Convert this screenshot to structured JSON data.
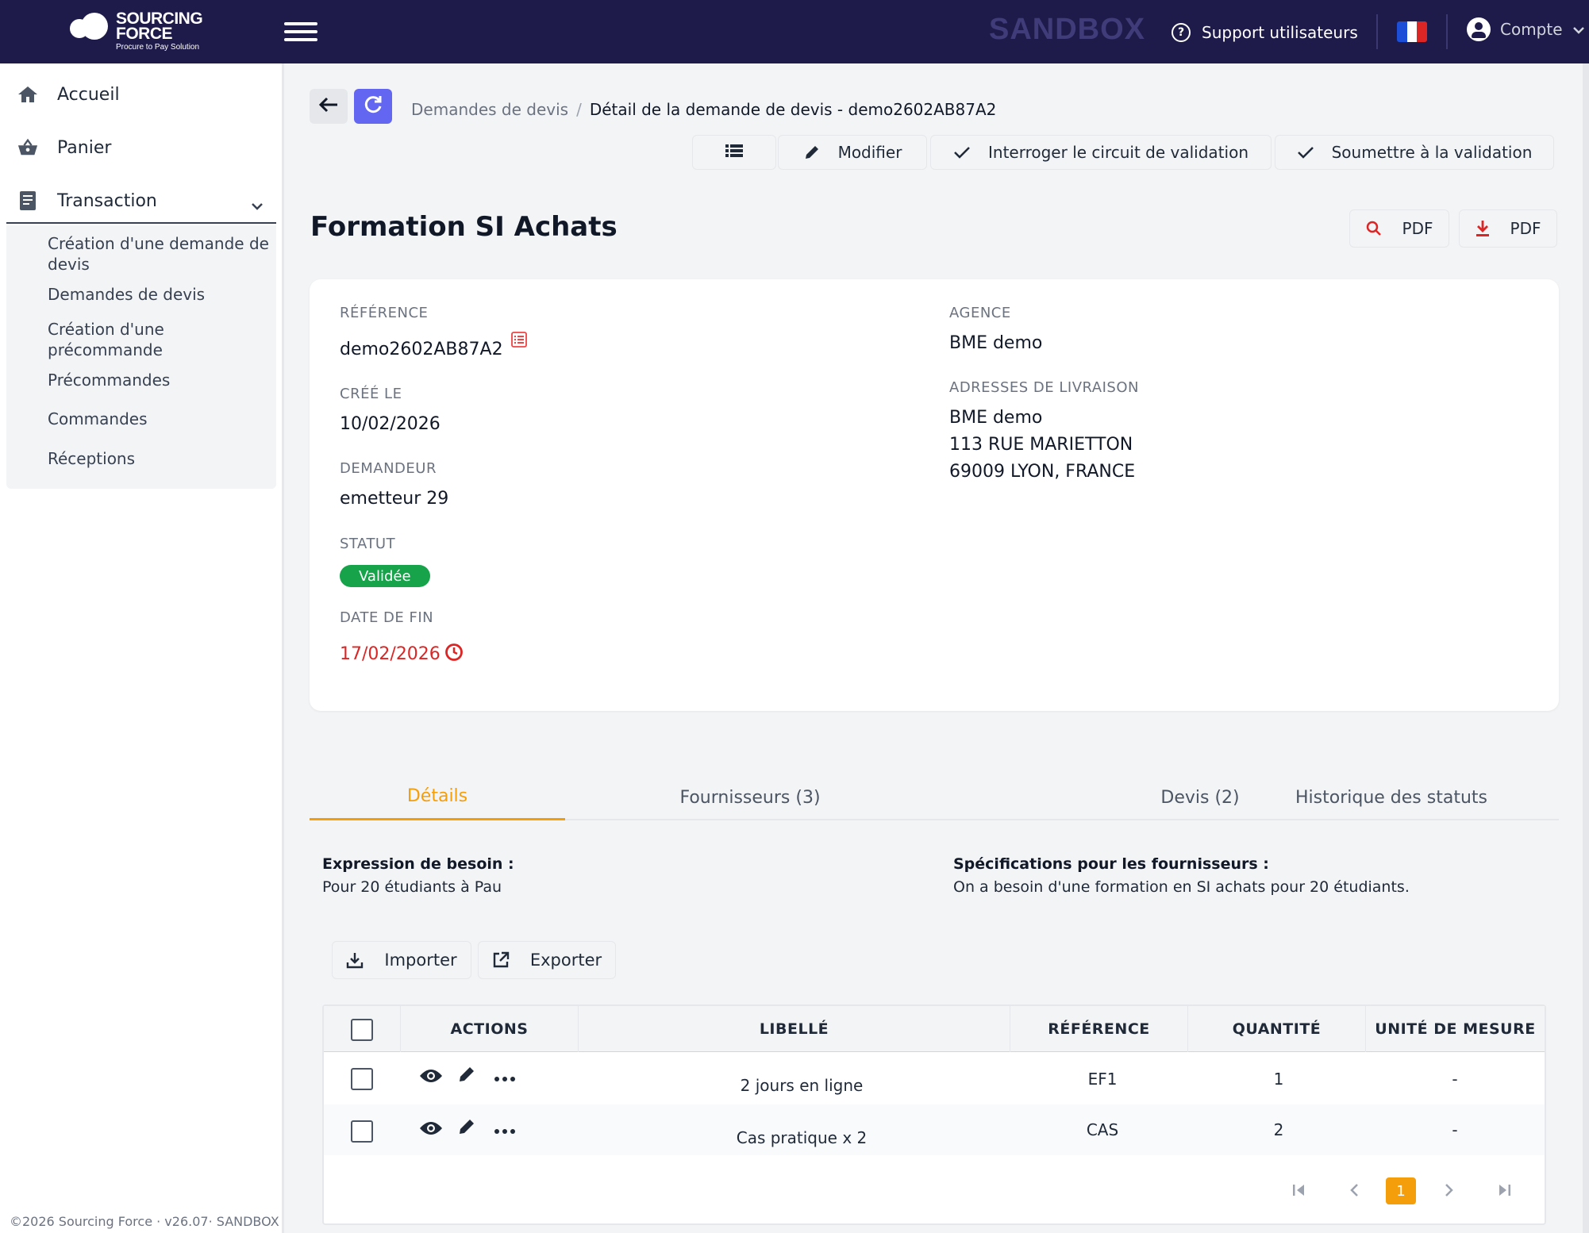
{
  "header": {
    "logo_line1": "SOURCING",
    "logo_line2": "FORCE",
    "logo_sub": "Procure to Pay Solution",
    "env": "SANDBOX",
    "support": "Support utilisateurs",
    "account": "Compte"
  },
  "sidebar": {
    "home": "Accueil",
    "cart": "Panier",
    "transaction": "Transaction",
    "sub": [
      "Création d'une demande de devis",
      "Demandes de devis",
      "Création d'une précommande",
      "Précommandes",
      "Commandes",
      "Réceptions"
    ],
    "footer": "©2026 Sourcing Force · v26.07· SANDBOX"
  },
  "breadcrumb": {
    "parent": "Demandes de devis",
    "separator": "/",
    "current": "Détail de la demande de devis - demo2602AB87A2"
  },
  "toolbar": {
    "edit": "Modifier",
    "query_circuit": "Interroger le circuit de validation",
    "submit": "Soumettre à la validation"
  },
  "page": {
    "title": "Formation SI Achats",
    "pdf_view": "PDF",
    "pdf_download": "PDF"
  },
  "details": {
    "ref_label": "RÉFÉRENCE",
    "ref_value": "demo2602AB87A2",
    "created_label": "CRÉÉ LE",
    "created_value": "10/02/2026",
    "requester_label": "DEMANDEUR",
    "requester_value": "emetteur 29",
    "status_label": "STATUT",
    "status_value": "Validée",
    "end_label": "DATE DE FIN",
    "end_value": "17/02/2026",
    "agency_label": "AGENCE",
    "agency_value": "BME demo",
    "delivery_label": "ADRESSES DE LIVRAISON",
    "delivery_lines": [
      "BME demo",
      "113 RUE MARIETTON",
      "69009 LYON, FRANCE"
    ]
  },
  "tabs": [
    "Détails",
    "Fournisseurs (3)",
    "Devis (2)",
    "Historique des statuts"
  ],
  "needs": {
    "expr_label": "Expression de besoin :",
    "expr_value": "Pour 20 étudiants à Pau",
    "spec_label": "Spécifications pour les fournisseurs :",
    "spec_value": "On a besoin d'une formation en SI achats pour 20 étudiants."
  },
  "actions": {
    "import": "Importer",
    "export": "Exporter"
  },
  "table": {
    "columns": [
      "ACTIONS",
      "LIBELLÉ",
      "RÉFÉRENCE",
      "QUANTITÉ",
      "UNITÉ DE MESURE"
    ],
    "rows": [
      {
        "label": "2 jours en ligne",
        "ref": "EF1",
        "qty": "1",
        "unit": "-"
      },
      {
        "label": "Cas pratique x 2",
        "ref": "CAS",
        "qty": "2",
        "unit": "-"
      }
    ],
    "current_page": "1"
  },
  "colors": {
    "topbar": "#1e1b4b",
    "accent": "#f59e0b",
    "refresh": "#6366f1",
    "status_ok": "#16a34a",
    "danger": "#dc2626"
  }
}
